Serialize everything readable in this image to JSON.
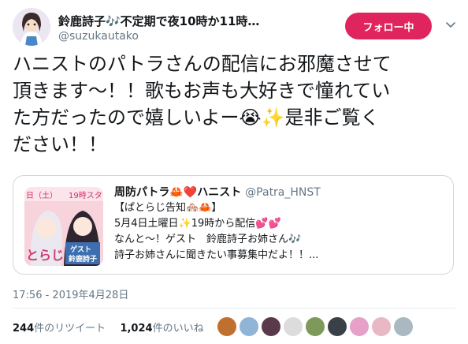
{
  "author": {
    "name": "鈴鹿詩子🎶不定期で夜10時か11時…",
    "handle": "@suzukautako",
    "avatar_icon": "user-avatar"
  },
  "follow_button": {
    "label": "フォロー中"
  },
  "tweet": {
    "lines": [
      "ハニストのパトラさんの配信にお邪魔させて",
      "頂きます〜！！歌もお声も大好きで憧れてい",
      "た方だったので嬉しいよー😭✨是非ご覧く",
      "ださい！！"
    ]
  },
  "quote": {
    "name": "周防パトラ🦀❤️ハニスト",
    "handle": "@Patra_HNST",
    "lines": [
      "【ぱとらじ告知🏘️🦀】",
      "5月4日土曜日✨19時から配信💕💕",
      "なんと〜！ゲスト　鈴鹿詩子お姉さん🎶",
      "詩子お姉さんに聞きたい事募集中だよ！！..."
    ],
    "thumb_texts": {
      "day": "日（土）",
      "time": "19時スタ",
      "title": "とらじ",
      "guest": "ゲスト",
      "guest_name": "鈴鹿詩子"
    }
  },
  "timestamp": "17:56 - 2019年4月28日",
  "stats": {
    "retweets": "244",
    "retweets_label": "件のリツイート",
    "likes": "1,024",
    "likes_label": "件のいいね"
  },
  "likers": [
    {
      "color": "#c0702e"
    },
    {
      "color": "#8fb4d6"
    },
    {
      "color": "#5a3a4a"
    },
    {
      "color": "#dcdcdc"
    },
    {
      "color": "#7d9a5a"
    },
    {
      "color": "#3a4048"
    },
    {
      "color": "#e7a0c8"
    },
    {
      "color": "#e8b8c4"
    },
    {
      "color": "#aab8c2"
    }
  ],
  "colors": {
    "follow_button": "#e0245e",
    "secondary_text": "#657786",
    "border": "#ccd6dd"
  }
}
